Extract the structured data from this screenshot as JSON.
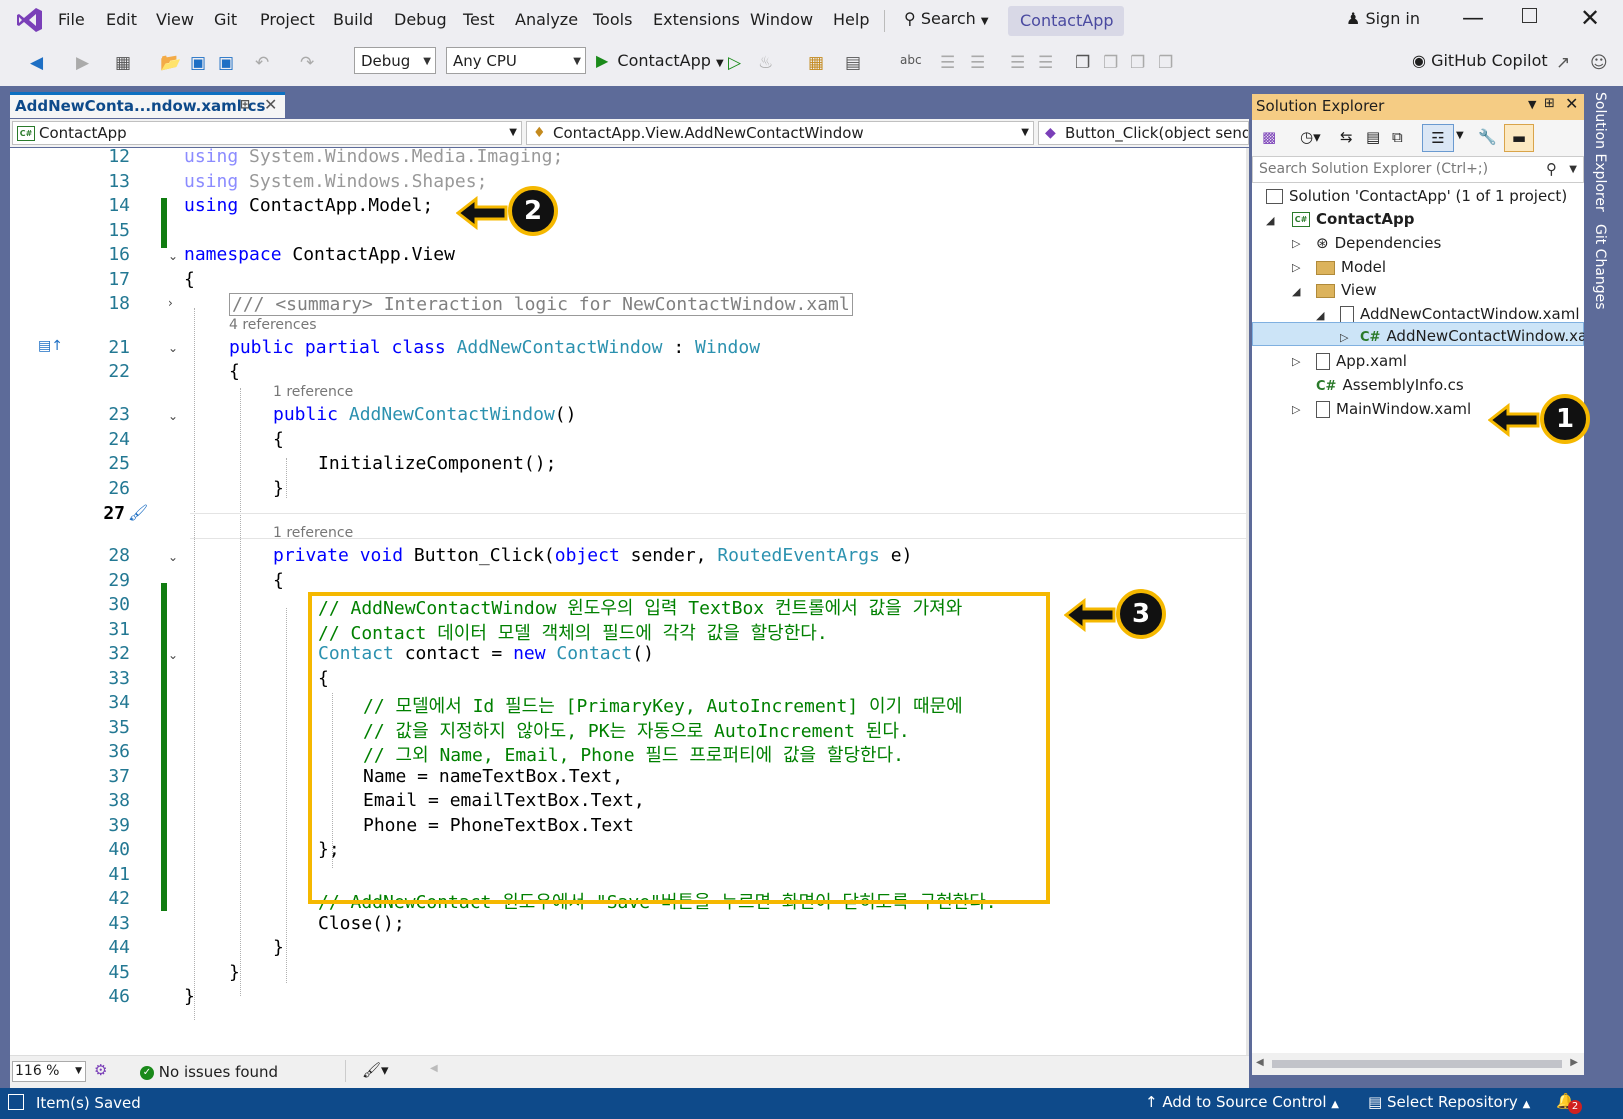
{
  "titlebar": {
    "menus": [
      "File",
      "Edit",
      "View",
      "Git",
      "Project",
      "Build",
      "Debug",
      "Test",
      "Analyze",
      "Tools",
      "Extensions",
      "Window",
      "Help"
    ],
    "search": "Search",
    "app_name": "ContactApp",
    "sign_in": "Sign in"
  },
  "toolbar": {
    "config": "Debug",
    "platform": "Any CPU",
    "run_target": "ContactApp",
    "copilot": "GitHub Copilot"
  },
  "document": {
    "tab_title": "AddNewConta...ndow.xaml.cs",
    "nav_project": "ContactApp",
    "nav_class": "ContactApp.View.AddNewContactWindow",
    "nav_member": "Button_Click(object sende"
  },
  "code": {
    "line_numbers": [
      "12",
      "13",
      "14",
      "15",
      "16",
      "17",
      "18",
      "21",
      "22",
      "23",
      "24",
      "25",
      "26",
      "27",
      "28",
      "29",
      "30",
      "31",
      "32",
      "33",
      "34",
      "35",
      "36",
      "37",
      "38",
      "39",
      "40",
      "41",
      "42",
      "43",
      "44",
      "45",
      "46"
    ],
    "l12_kw": "using",
    "l12_rest": " System.Windows.Media.Imaging;",
    "l13_kw": "using",
    "l13_rest": " System.Windows.Shapes;",
    "l14_kw": "using",
    "l14_rest": " ContactApp.Model;",
    "l16_kw": "namespace",
    "l16_rest": " ContactApp.View",
    "l17": "{",
    "l18": "/// <summary> Interaction logic for NewContactWindow.xaml",
    "lens_4refs": "4 references",
    "l21_kw": "public partial class",
    "l21_type": "AddNewContactWindow",
    "l21_colon": " : ",
    "l21_base": "Window",
    "l22": "{",
    "lens_1ref_a": "1 reference",
    "l23_kw": "public",
    "l23_type": "AddNewContactWindow",
    "l23_rest": "()",
    "l24": "{",
    "l25": "InitializeComponent();",
    "l26": "}",
    "lens_1ref_b": "1 reference",
    "l28_kw": "private void",
    "l28_name": " Button_Click(",
    "l28_kw2": "object",
    "l28_mid": " sender, ",
    "l28_type": "RoutedEventArgs",
    "l28_end": " e)",
    "l29": "{",
    "l30": "// AddNewContactWindow 윈도우의 입력 TextBox 컨트롤에서 값을 가져와",
    "l31": "// Contact 데이터 모델 객체의 필드에 각각 값을 할당한다.",
    "l32_type": "Contact",
    "l32_mid": " contact = ",
    "l32_kw": "new",
    "l32_type2": " Contact",
    "l32_end": "()",
    "l33": "{",
    "l34": "// 모델에서 Id 필드는 [PrimaryKey, AutoIncrement] 이기 때문에",
    "l35": "// 값을 지정하지 않아도, PK는 자동으로 AutoIncrement 된다.",
    "l36": "// 그외 Name, Email, Phone 필드 프로퍼티에 값을 할당한다.",
    "l37": "Name = nameTextBox.Text,",
    "l38": "Email = emailTextBox.Text,",
    "l39": "Phone = PhoneTextBox.Text",
    "l40": "};",
    "l42": "// AddNewContact 윈도우에서 \"Save\"버튼을 누르면 화면이 닫히도록 구현한다.",
    "l43": "Close();",
    "l44": "}",
    "l45": "}",
    "l46": "}"
  },
  "editor_status": {
    "zoom": "116 %",
    "issues": "No issues found"
  },
  "solution_explorer": {
    "title": "Solution Explorer",
    "search_placeholder": "Search Solution Explorer (Ctrl+;)",
    "solution": "Solution 'ContactApp' (1 of 1 project)",
    "project": "ContactApp",
    "dependencies": "Dependencies",
    "model": "Model",
    "view": "View",
    "add_window_xaml": "AddNewContactWindow.xaml",
    "add_window_cs": "AddNewContactWindow.xam",
    "app_xaml": "App.xaml",
    "assembly_info": "AssemblyInfo.cs",
    "main_window": "MainWindow.xaml"
  },
  "side_tabs": {
    "solution_explorer": "Solution Explorer",
    "git_changes": "Git Changes"
  },
  "statusbar": {
    "saved": "Item(s) Saved",
    "add_source": "Add to Source Control",
    "select_repo": "Select Repository",
    "notif_count": "2"
  },
  "callouts": [
    "1",
    "2",
    "3"
  ],
  "colors": {
    "accent": "#0e4a8a",
    "highlight": "#f5b800",
    "comment": "#008000",
    "keyword": "#0000ff",
    "type": "#2b91af"
  }
}
